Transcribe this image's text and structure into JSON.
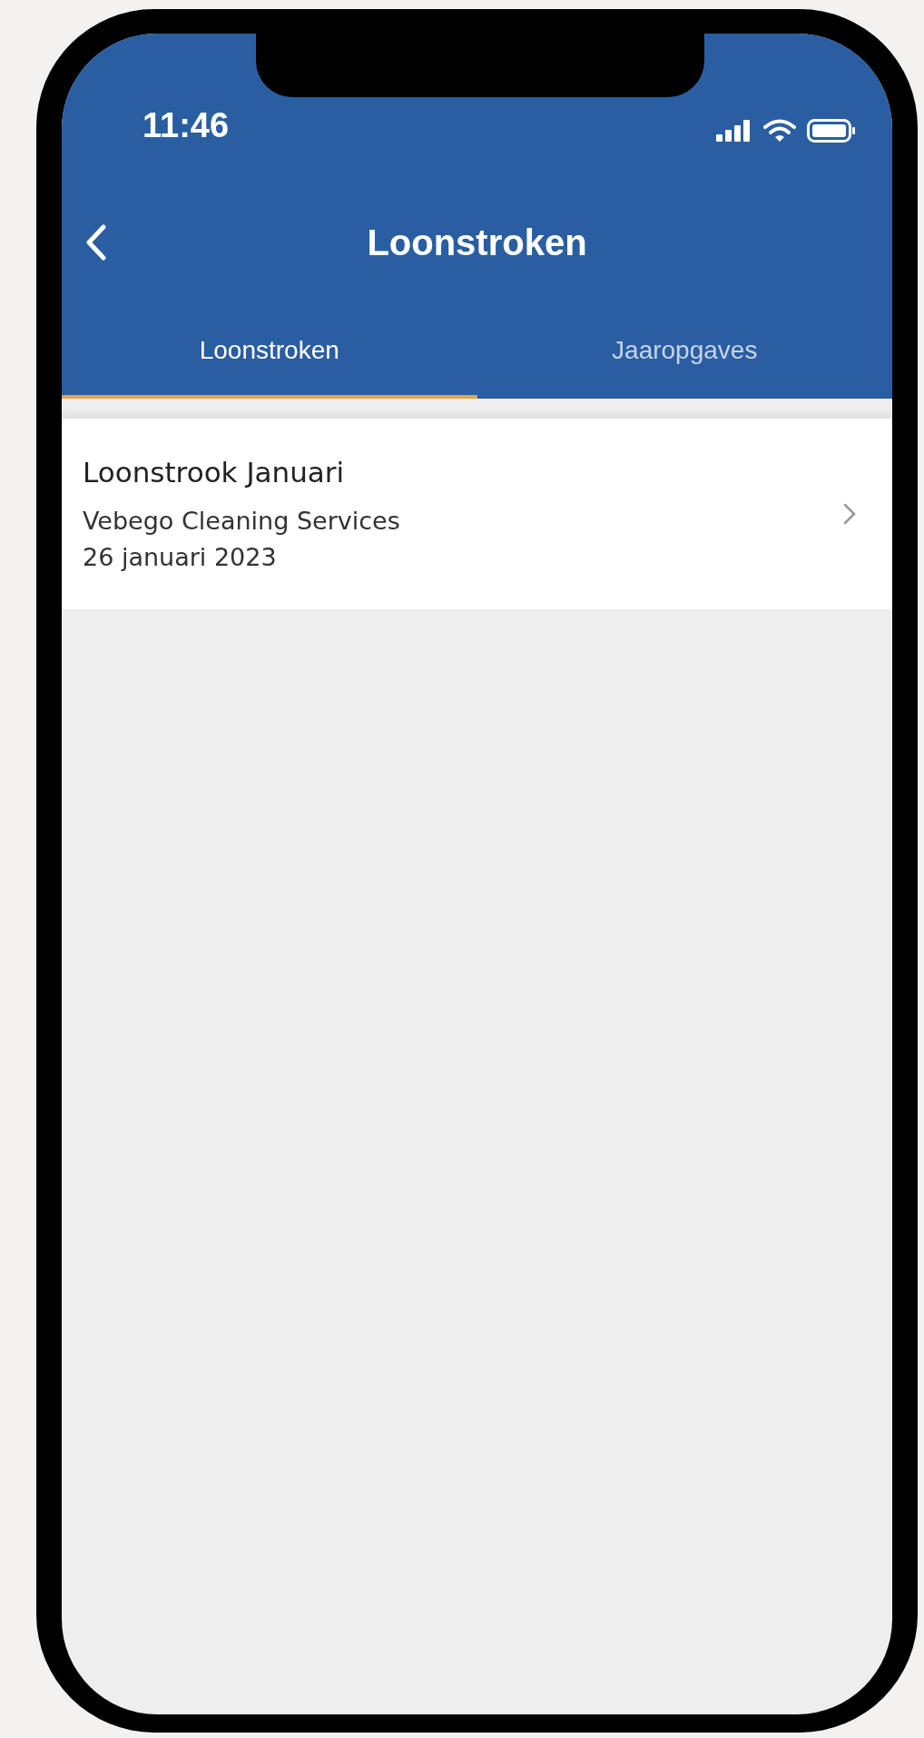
{
  "status_bar": {
    "time": "11:46"
  },
  "header": {
    "title": "Loonstroken"
  },
  "tabs": [
    {
      "label": "Loonstroken",
      "selected": true
    },
    {
      "label": "Jaaropgaves",
      "selected": false
    }
  ],
  "payslips": [
    {
      "title": "Loonstrook Januari",
      "employer": "Vebego Cleaning Services",
      "date": "26 januari 2023"
    }
  ]
}
